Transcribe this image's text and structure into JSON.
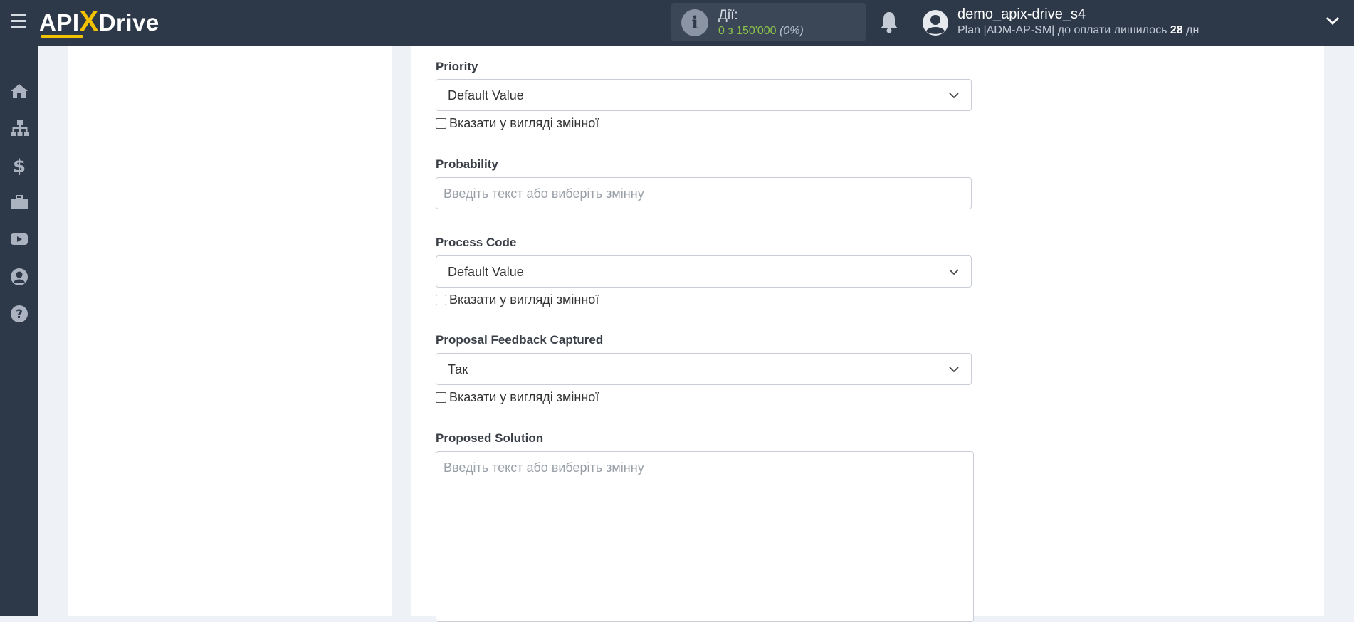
{
  "header": {
    "logo_api": "API",
    "logo_x": "X",
    "logo_drive": "Drive",
    "actions_label": "Дії:",
    "actions_count": "0 з 150'000",
    "actions_percent": "(0%)",
    "user_name": "demo_apix-drive_s4",
    "plan_prefix": "Plan |ADM-AP-SM| до оплати лишилось",
    "plan_days": "28",
    "plan_suffix": "дн"
  },
  "sidebar": {
    "items": [
      {
        "icon": "home-icon"
      },
      {
        "icon": "sitemap-icon"
      },
      {
        "icon": "dollar-icon"
      },
      {
        "icon": "briefcase-icon"
      },
      {
        "icon": "youtube-icon"
      },
      {
        "icon": "user-icon"
      },
      {
        "icon": "help-icon"
      }
    ]
  },
  "form": {
    "priority": {
      "label": "Priority",
      "value": "Default Value",
      "checkbox_label": "Вказати у вигляді змінної",
      "checked": false
    },
    "probability": {
      "label": "Probability",
      "placeholder": "Введіть текст або виберіть змінну"
    },
    "process_code": {
      "label": "Process Code",
      "value": "Default Value",
      "checkbox_label": "Вказати у вигляді змінної",
      "checked": false
    },
    "proposal_feedback": {
      "label": "Proposal Feedback Captured",
      "value": "Так",
      "checkbox_label": "Вказати у вигляді змінної",
      "checked": false
    },
    "proposed_solution": {
      "label": "Proposed Solution",
      "placeholder": "Введіть текст або виберіть змінну"
    }
  },
  "colors": {
    "topbar": "#2d3949",
    "accent_yellow": "#f2c200",
    "actions_green": "#8bc34a",
    "background": "#eef1f6"
  }
}
